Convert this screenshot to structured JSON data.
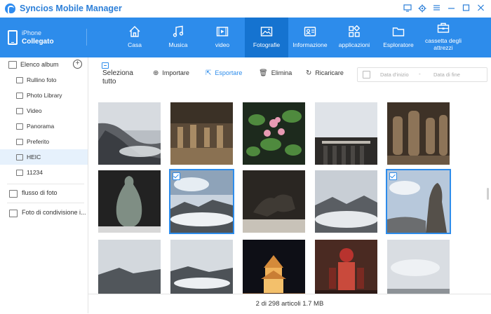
{
  "app": {
    "title": "Syncios Mobile Manager",
    "brand_color": "#2d8ceb"
  },
  "window_controls": [
    "screen-icon",
    "gear-icon",
    "menu-icon",
    "minimize-icon",
    "maximize-icon",
    "close-icon"
  ],
  "device": {
    "name": "iPhone",
    "status": "Collegato"
  },
  "nav": {
    "tabs": [
      {
        "label": "Casa",
        "icon": "home-icon"
      },
      {
        "label": "Musica",
        "icon": "music-icon"
      },
      {
        "label": "video",
        "icon": "video-icon"
      },
      {
        "label": "Fotografie",
        "icon": "photo-icon",
        "active": true
      },
      {
        "label": "Informazione",
        "icon": "contact-card-icon"
      },
      {
        "label": "applicazioni",
        "icon": "apps-icon"
      },
      {
        "label": "Esploratore",
        "icon": "folder-icon"
      },
      {
        "label": "cassetta degli attrezzi",
        "icon": "toolbox-icon"
      }
    ]
  },
  "sidebar": {
    "header": "Elenco album",
    "albums": [
      {
        "label": "Rullino foto"
      },
      {
        "label": "Photo Library"
      },
      {
        "label": "Video"
      },
      {
        "label": "Panorama"
      },
      {
        "label": "Preferito"
      },
      {
        "label": "HEIC",
        "active": true
      },
      {
        "label": "11234"
      }
    ],
    "photo_stream": "flusso di foto",
    "shared": "Foto di condivisione i..."
  },
  "toolbar": {
    "select_all": "Seleziona tutto",
    "import": "Importare",
    "export": "Esportare",
    "delete": "Elimina",
    "reload": "Ricaricare",
    "date_start_placeholder": "Data d'inizio",
    "date_end_placeholder": "Data di fine",
    "date_sep": "-"
  },
  "photos": [
    {
      "subject": "mountain-clouds",
      "selected": false
    },
    {
      "subject": "terracotta-warriors",
      "selected": false
    },
    {
      "subject": "pink-flowers",
      "selected": false
    },
    {
      "subject": "building",
      "selected": false
    },
    {
      "subject": "terracotta-statues",
      "selected": false
    },
    {
      "subject": "vase",
      "selected": false
    },
    {
      "subject": "sea-of-clouds",
      "selected": true
    },
    {
      "subject": "bronze-sculpture",
      "selected": false
    },
    {
      "subject": "mountain-clouds-2",
      "selected": false
    },
    {
      "subject": "cliff-peak",
      "selected": true
    },
    {
      "subject": "mountain-mist",
      "selected": false
    },
    {
      "subject": "tower-night",
      "selected": false
    },
    {
      "subject": "costumed-figure",
      "selected": false
    },
    {
      "subject": "cloudy-sky",
      "selected": false
    }
  ],
  "status": {
    "text": "2 di 298 articoli 1.7 MB"
  }
}
